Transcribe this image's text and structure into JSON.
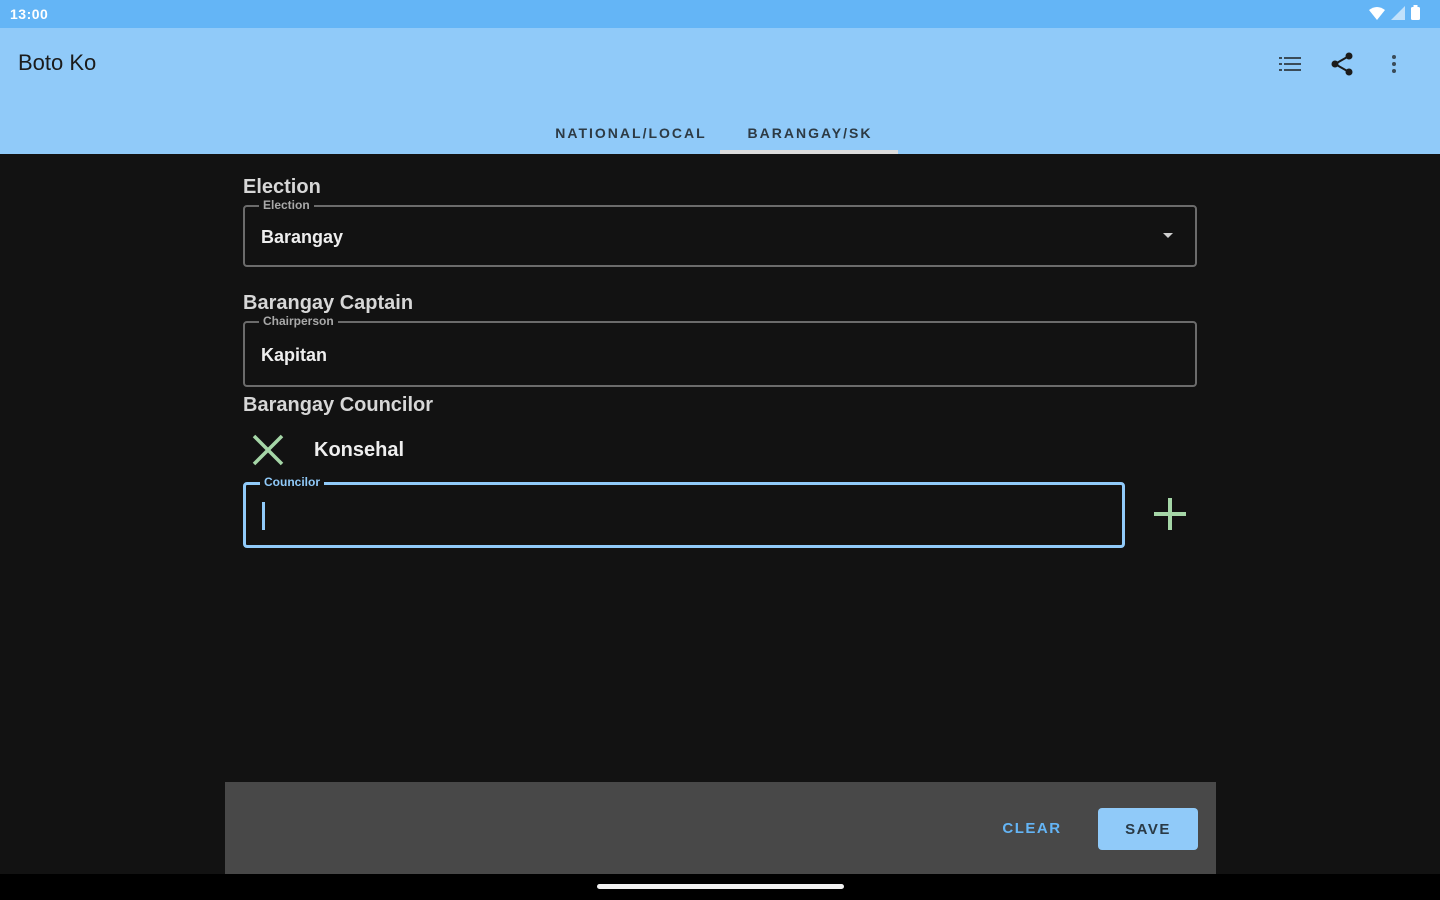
{
  "status_bar": {
    "time": "13:00",
    "icons": [
      "wifi-icon",
      "signal-icon",
      "battery-icon"
    ]
  },
  "app_bar": {
    "title": "Boto Ko",
    "actions": [
      "list-icon",
      "share-icon",
      "more-vert-icon"
    ]
  },
  "tabs": [
    {
      "label": "NATIONAL/LOCAL",
      "selected": false
    },
    {
      "label": "BARANGAY/SK",
      "selected": true
    }
  ],
  "election": {
    "section_label": "Election",
    "field_label": "Election",
    "value": "Barangay"
  },
  "captain": {
    "section_label": "Barangay Captain",
    "field_label": "Chairperson",
    "value": "Kapitan"
  },
  "councilor": {
    "section_label": "Barangay Councilor",
    "entries": [
      "Konsehal"
    ],
    "field_label": "Councilor",
    "value": ""
  },
  "footer": {
    "clear_label": "CLEAR",
    "save_label": "SAVE"
  },
  "colors": {
    "status_bar": "#64b5f6",
    "app_bar": "#90caf9",
    "background": "#121212",
    "accent_green": "#a5d6a7",
    "button_blue": "#90caf9"
  }
}
